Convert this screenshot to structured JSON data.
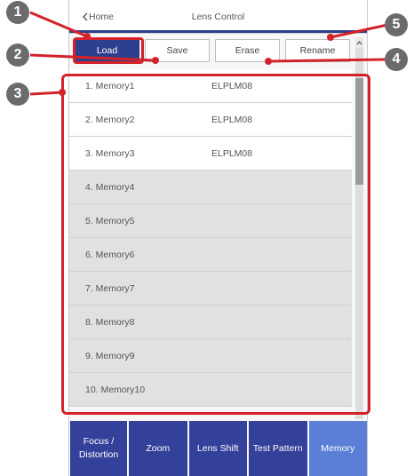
{
  "header": {
    "back_label": "Home",
    "title": "Lens Control"
  },
  "actions": [
    {
      "label": "Load",
      "active": true
    },
    {
      "label": "Save"
    },
    {
      "label": "Erase"
    },
    {
      "label": "Rename"
    }
  ],
  "memories": [
    {
      "name": "1. Memory1",
      "lens": "ELPLM08"
    },
    {
      "name": "2. Memory2",
      "lens": "ELPLM08"
    },
    {
      "name": "3. Memory3",
      "lens": "ELPLM08"
    },
    {
      "name": "4. Memory4",
      "lens": ""
    },
    {
      "name": "5. Memory5",
      "lens": ""
    },
    {
      "name": "6. Memory6",
      "lens": ""
    },
    {
      "name": "7. Memory7",
      "lens": ""
    },
    {
      "name": "8. Memory8",
      "lens": ""
    },
    {
      "name": "9. Memory9",
      "lens": ""
    },
    {
      "name": "10. Memory10",
      "lens": ""
    }
  ],
  "tabs": [
    {
      "label": "Focus /\nDistortion"
    },
    {
      "label": "Zoom"
    },
    {
      "label": "Lens Shift"
    },
    {
      "label": "Test Pattern"
    },
    {
      "label": "Memory",
      "active": true
    }
  ],
  "callouts": [
    "1",
    "2",
    "3",
    "4",
    "5"
  ],
  "colors": {
    "accent": "#2c3e8c",
    "tab": "#34419a",
    "tab_active": "#5b7fd6",
    "callout": "#d4222a",
    "badge": "#6b6b6b"
  }
}
